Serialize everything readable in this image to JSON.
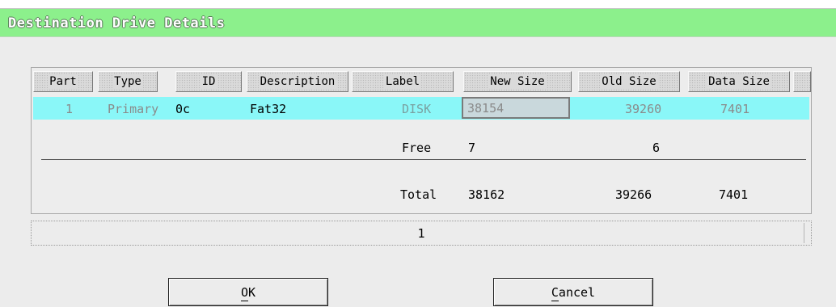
{
  "window": {
    "title": "Destination Drive Details"
  },
  "table": {
    "headers": [
      "Part",
      "Type",
      "ID",
      "Description",
      "Label",
      "New Size",
      "Old Size",
      "Data Size"
    ],
    "row": {
      "part": "1",
      "type": "Primary",
      "id": "0c",
      "description": "Fat32",
      "label": "DISK",
      "new_size": "38154",
      "old_size": "39260",
      "data_size": "7401"
    },
    "free": {
      "label": "Free",
      "new_size": "7",
      "old_size": "6"
    },
    "total": {
      "label": "Total",
      "new_size": "38162",
      "old_size": "39266",
      "data_size": "7401"
    }
  },
  "pager": {
    "page": "1"
  },
  "buttons": {
    "ok": "OK",
    "cancel": "Cancel"
  },
  "colors": {
    "titlebar": "#8cf08c",
    "selected_row": "#8af7f8",
    "window_bg": "#ececec"
  }
}
